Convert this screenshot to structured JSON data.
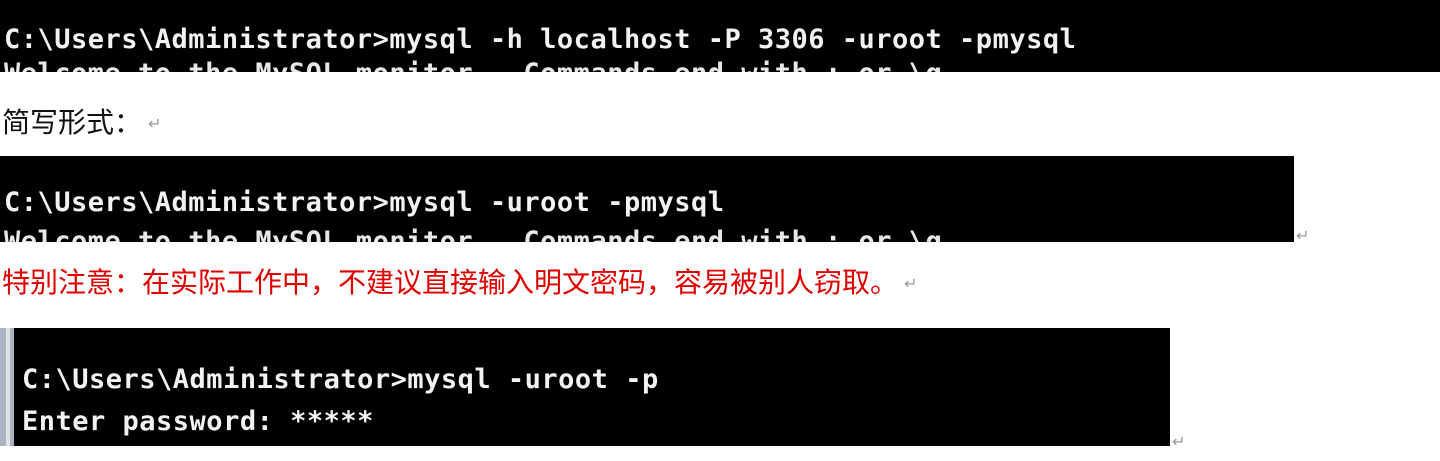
{
  "terminal1": {
    "line1": "C:\\Users\\Administrator>mysql -h localhost -P 3306 -uroot -pmysql",
    "line2_cut": "Welcome to the MySQL monitor.  Commands end with ; or \\g."
  },
  "label_short": "简写形式：",
  "terminal2": {
    "line1": "C:\\Users\\Administrator>mysql -uroot -pmysql",
    "line2_cut": "Welcome to the MySQL monitor.  Commands end with ; or \\g."
  },
  "label_warning": "特别注意：在实际工作中，不建议直接输入明文密码，容易被别人窃取。",
  "terminal3": {
    "line1": "C:\\Users\\Administrator>mysql -uroot -p",
    "line2": "Enter password: *****"
  },
  "paragraph_mark": "↵",
  "colors": {
    "terminal_bg": "#000000",
    "terminal_fg": "#f2f2f2",
    "warning_text": "#e00000"
  }
}
